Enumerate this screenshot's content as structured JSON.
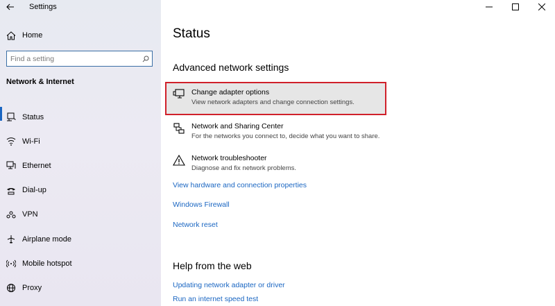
{
  "window": {
    "app_title": "Settings",
    "controls": {
      "minimize": "—",
      "maximize": "☐",
      "close": "✕"
    }
  },
  "sidebar": {
    "home_label": "Home",
    "search": {
      "placeholder": "Find a setting"
    },
    "section_title": "Network & Internet",
    "items": [
      {
        "label": "Status",
        "icon": "status-icon",
        "active": true
      },
      {
        "label": "Wi-Fi",
        "icon": "wifi-icon"
      },
      {
        "label": "Ethernet",
        "icon": "ethernet-icon"
      },
      {
        "label": "Dial-up",
        "icon": "dialup-icon"
      },
      {
        "label": "VPN",
        "icon": "vpn-icon"
      },
      {
        "label": "Airplane mode",
        "icon": "airplane-icon"
      },
      {
        "label": "Mobile hotspot",
        "icon": "hotspot-icon"
      },
      {
        "label": "Proxy",
        "icon": "globe-icon"
      }
    ]
  },
  "main": {
    "title": "Status",
    "advanced_heading": "Advanced network settings",
    "options": [
      {
        "title": "Change adapter options",
        "desc": "View network adapters and change connection settings.",
        "icon": "monitor-icon"
      },
      {
        "title": "Network and Sharing Center",
        "desc": "For the networks you connect to, decide what you want to share.",
        "icon": "sharing-center-icon"
      },
      {
        "title": "Network troubleshooter",
        "desc": "Diagnose and fix network problems.",
        "icon": "warning-icon"
      }
    ],
    "links": [
      "View hardware and connection properties",
      "Windows Firewall",
      "Network reset"
    ],
    "help_heading": "Help from the web",
    "help_links": [
      "Updating network adapter or driver",
      "Run an internet speed test"
    ]
  },
  "colors": {
    "accent": "#1a66c2",
    "highlight_border": "#d0202a",
    "sidebar_bg": "#e9e9f1"
  }
}
